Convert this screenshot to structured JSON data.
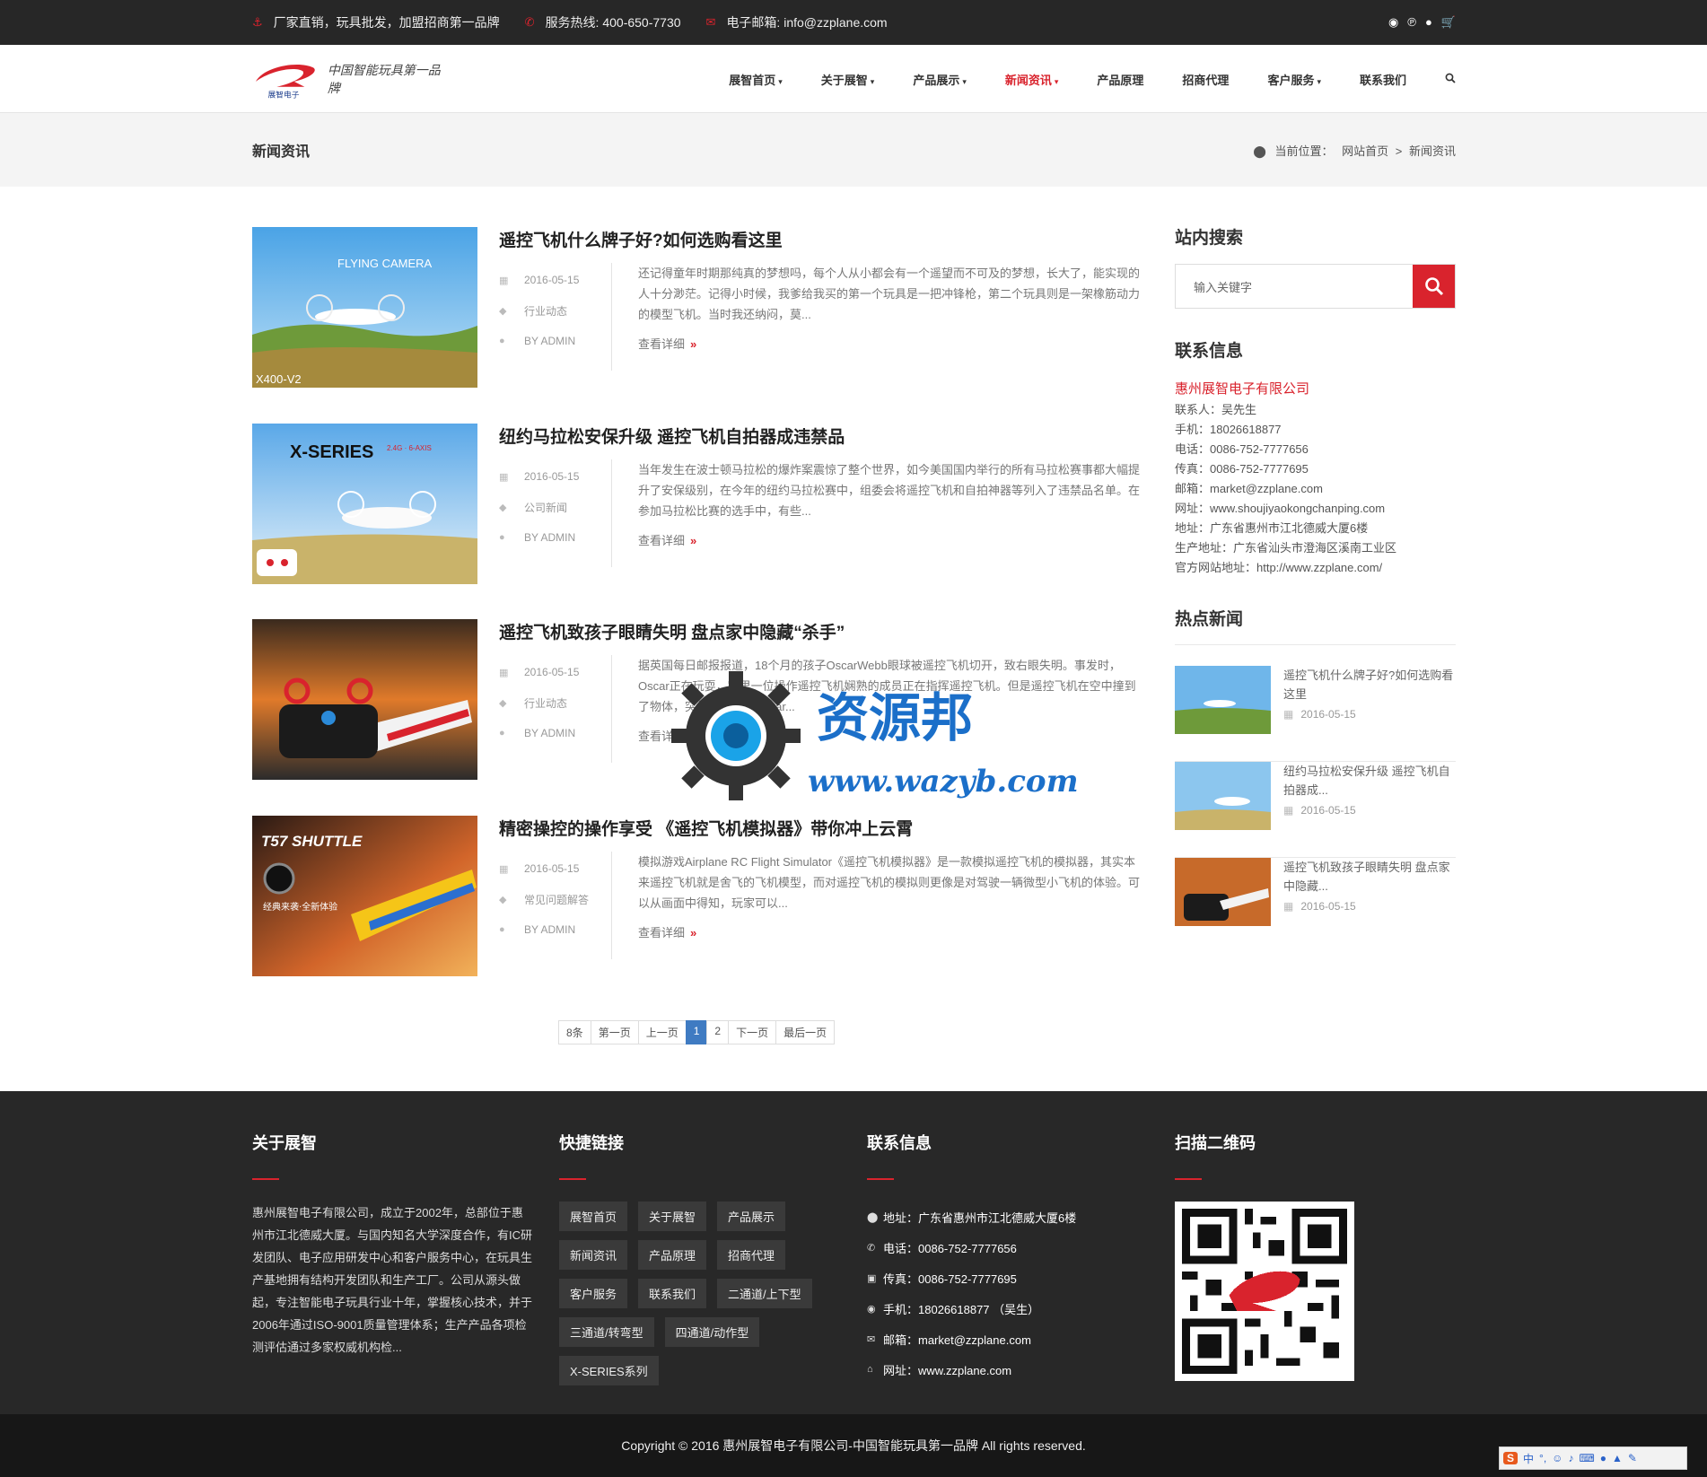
{
  "topbar": {
    "slogan": "厂家直销，玩具批发，加盟招商第一品牌",
    "hotline": "服务热线: 400-650-7730",
    "email": "电子邮箱: info@zzplane.com",
    "icons": [
      "weibo-icon",
      "pinterest-icon",
      "qq-icon",
      "cart-icon"
    ]
  },
  "header": {
    "logo_text": "展智电子",
    "slogan": "中国智能玩具第一品牌",
    "nav": [
      {
        "label": "展智首页",
        "caret": "▾"
      },
      {
        "label": "关于展智",
        "caret": "▾"
      },
      {
        "label": "产品展示",
        "caret": "▾"
      },
      {
        "label": "新闻资讯",
        "caret": "▾",
        "active": true
      },
      {
        "label": "产品原理",
        "caret": ""
      },
      {
        "label": "招商代理",
        "caret": ""
      },
      {
        "label": "客户服务",
        "caret": "▾"
      },
      {
        "label": "联系我们",
        "caret": ""
      }
    ]
  },
  "page_head": {
    "title": "新闻资讯",
    "crumb_label": "当前位置：",
    "crumb_home": "网站首页",
    "crumb_sep": ">",
    "crumb_current": "新闻资讯"
  },
  "articles": [
    {
      "title": "遥控飞机什么牌子好?如何选购看这里",
      "date": "2016-05-15",
      "category": "行业动态",
      "author": "BY ADMIN",
      "excerpt": "还记得童年时期那纯真的梦想吗，每个人从小都会有一个遥望而不可及的梦想，长大了，能实现的人十分渺茫。记得小时候，我爹给我买的第一个玩具是一把冲锋枪，第二个玩具则是一架橡筋动力的模型飞机。当时我还纳闷，莫...",
      "more": "查看详细",
      "thumb_caption": "FLYING CAMERA",
      "thumb_model": "X400-V2"
    },
    {
      "title": "纽约马拉松安保升级 遥控飞机自拍器成违禁品",
      "date": "2016-05-15",
      "category": "公司新闻",
      "author": "BY ADMIN",
      "excerpt": "当年发生在波士顿马拉松的爆炸案震惊了整个世界，如今美国国内举行的所有马拉松赛事都大幅提升了安保级别，在今年的纽约马拉松赛中，组委会将遥控飞机和自拍神器等列入了违禁品名单。在参加马拉松比赛的选手中，有些...",
      "more": "查看详细",
      "thumb_caption": "X-SERIES",
      "thumb_sub": "2.4G · 6-AXIS"
    },
    {
      "title": "遥控飞机致孩子眼睛失明 盘点家中隐藏“杀手”",
      "date": "2016-05-15",
      "category": "行业动态",
      "author": "BY ADMIN",
      "excerpt": "据英国每日邮报报道，18个月的孩子OscarWebb眼球被遥控飞机切开，致右眼失明。事发时，Oscar正在玩耍，家里一位操作遥控飞机娴熟的成员正在指挥遥控飞机。但是遥控飞机在空中撞到了物体，突然失控飞向Oscar...",
      "more": "查看详细"
    },
    {
      "title": "精密操控的操作享受 《遥控飞机模拟器》带你冲上云霄",
      "date": "2016-05-15",
      "category": "常见问题解答",
      "author": "BY ADMIN",
      "excerpt": "模拟游戏Airplane RC Flight Simulator《遥控飞机模拟器》是一款模拟遥控飞机的模拟器，其实本来遥控飞机就是舍飞的飞机模型，而对遥控飞机的模拟则更像是对驾驶一辆微型小飞机的体验。可以从画面中得知，玩家可以...",
      "more": "查看详细",
      "thumb_caption": "T57 SHUTTLE",
      "thumb_sub": "经典来袭·全新体验"
    }
  ],
  "pager": [
    "8条",
    "第一页",
    "上一页",
    "1",
    "2",
    "下一页",
    "最后一页"
  ],
  "sidebar": {
    "search_title": "站内搜索",
    "search_placeholder": "输入关键字",
    "contact_title": "联系信息",
    "company": "惠州展智电子有限公司",
    "contact_lines": [
      "联系人：吴先生",
      "手机：18026618877",
      "电话：0086-752-7777656",
      "传真：0086-752-7777695",
      "邮箱：market@zzplane.com",
      "网址：www.shoujiyaokongchanping.com",
      "地址：广东省惠州市江北德威大厦6楼",
      "生产地址：广东省汕头市澄海区溪南工业区",
      "官方网站地址：http://www.zzplane.com/"
    ],
    "hot_title": "热点新闻",
    "hot": [
      {
        "title": "遥控飞机什么牌子好?如何选购看这里",
        "date": "2016-05-15"
      },
      {
        "title": "纽约马拉松安保升级 遥控飞机自拍器成...",
        "date": "2016-05-15"
      },
      {
        "title": "遥控飞机致孩子眼睛失明 盘点家中隐藏...",
        "date": "2016-05-15"
      }
    ]
  },
  "watermark": {
    "name": "资源邦",
    "url": "www.wazyb.com"
  },
  "footer": {
    "about_title": "关于展智",
    "about_text": "惠州展智电子有限公司，成立于2002年，总部位于惠州市江北德威大厦。与国内知名大学深度合作，有IC研发团队、电子应用研发中心和客户服务中心，在玩具生产基地拥有结构开发团队和生产工厂。公司从源头做起，专注智能电子玩具行业十年，掌握核心技术，并于2006年通过ISO-9001质量管理体系；生产产品各项检测评估通过多家权威机构检...",
    "links_title": "快捷链接",
    "links": [
      "展智首页",
      "关于展智",
      "产品展示",
      "新闻资讯",
      "产品原理",
      "招商代理",
      "客户服务",
      "联系我们",
      "二通道/上下型",
      "三通道/转弯型",
      "四通道/动作型",
      "X-SERIES系列"
    ],
    "contact_title": "联系信息",
    "contact": [
      {
        "icon": "map-marker-icon",
        "text": "地址：广东省惠州市江北德威大厦6楼"
      },
      {
        "icon": "phone-icon",
        "text": "电话：0086-752-7777656"
      },
      {
        "icon": "fax-icon",
        "text": "传真：0086-752-7777695"
      },
      {
        "icon": "mobile-icon",
        "text": "手机：18026618877 （吴生）"
      },
      {
        "icon": "envelope-icon",
        "text": "邮箱：market@zzplane.com"
      },
      {
        "icon": "home-icon",
        "text": "网址：www.zzplane.com"
      }
    ],
    "qr_title": "扫描二维码"
  },
  "copyright": "Copyright © 2016 惠州展智电子有限公司-中国智能玩具第一品牌 All rights reserved.",
  "ime": {
    "label": "中"
  },
  "colors": {
    "accent": "#d9232d",
    "topbar": "#272727",
    "footer": "#282828",
    "pager_active": "#3f7bc2"
  }
}
